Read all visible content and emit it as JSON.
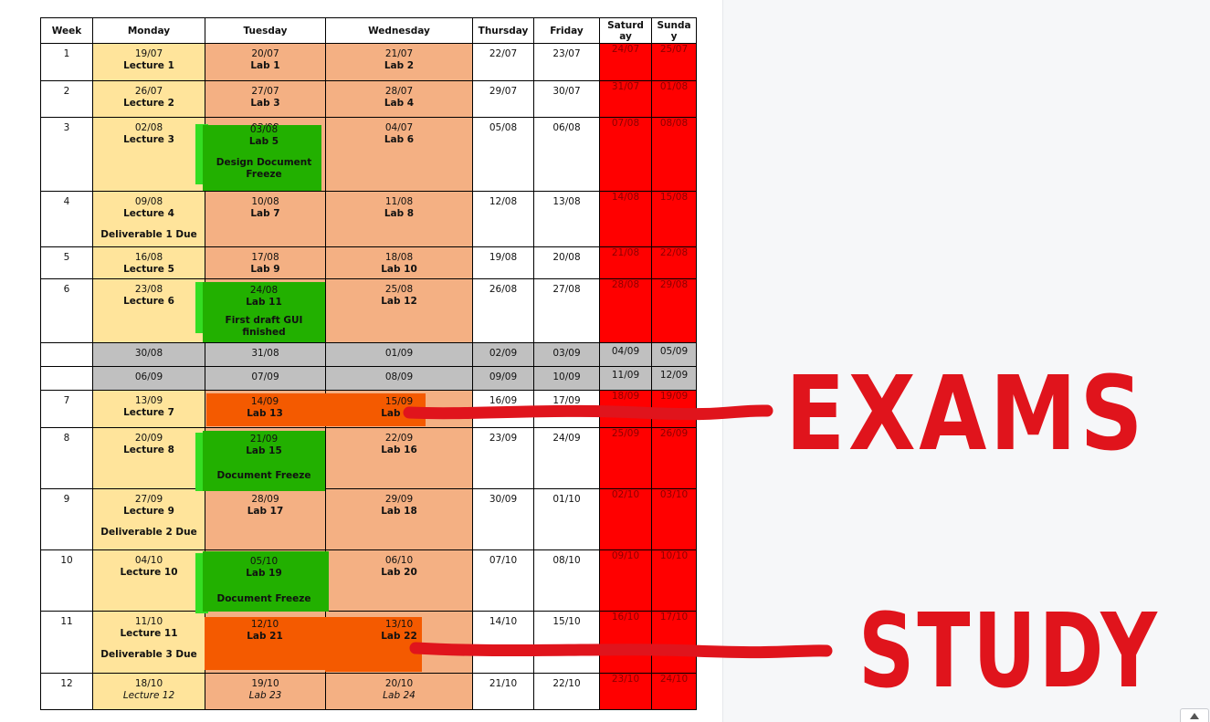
{
  "table": {
    "headers": [
      "Week",
      "Monday",
      "Tuesday",
      "Wednesday",
      "Thursday",
      "Friday",
      "Saturd\nay",
      "Sunda\ny"
    ],
    "rows": [
      {
        "week": "1",
        "mon": {
          "date": "19/07",
          "label": "Lecture 1"
        },
        "tue": {
          "date": "20/07",
          "label": "Lab 1"
        },
        "wed": {
          "date": "21/07",
          "label": "Lab 2"
        },
        "thu": "22/07",
        "fri": "23/07",
        "sat": "24/07",
        "sun": "25/07"
      },
      {
        "week": "2",
        "mon": {
          "date": "26/07",
          "label": "Lecture 2"
        },
        "tue": {
          "date": "27/07",
          "label": "Lab 3"
        },
        "wed": {
          "date": "28/07",
          "label": "Lab 4"
        },
        "thu": "29/07",
        "fri": "30/07",
        "sat": "31/07",
        "sun": "01/08"
      },
      {
        "week": "3",
        "mon": {
          "date": "02/08",
          "label": "Lecture 3"
        },
        "tue": {
          "date": "03/08",
          "label": "Lab 5",
          "note": "Design Document Freeze"
        },
        "wed": {
          "date": "04/07",
          "label": "Lab 6"
        },
        "thu": "05/08",
        "fri": "06/08",
        "sat": "07/08",
        "sun": "08/08"
      },
      {
        "week": "4",
        "mon": {
          "date": "09/08",
          "label": "Lecture 4",
          "note": "Deliverable 1 Due"
        },
        "tue": {
          "date": "10/08",
          "label": "Lab 7"
        },
        "wed": {
          "date": "11/08",
          "label": "Lab 8"
        },
        "thu": "12/08",
        "fri": "13/08",
        "sat": "14/08",
        "sun": "15/08"
      },
      {
        "week": "5",
        "mon": {
          "date": "16/08",
          "label": "Lecture 5"
        },
        "tue": {
          "date": "17/08",
          "label": "Lab 9"
        },
        "wed": {
          "date": "18/08",
          "label": "Lab 10"
        },
        "thu": "19/08",
        "fri": "20/08",
        "sat": "21/08",
        "sun": "22/08"
      },
      {
        "week": "6",
        "mon": {
          "date": "23/08",
          "label": "Lecture 6"
        },
        "tue": {
          "date": "24/08",
          "label": "Lab 11",
          "note": "First draft GUI finished"
        },
        "wed": {
          "date": "25/08",
          "label": "Lab 12"
        },
        "thu": "26/08",
        "fri": "27/08",
        "sat": "28/08",
        "sun": "29/08"
      },
      {
        "week": "",
        "break": true,
        "mon": {
          "date": "30/08"
        },
        "tue": {
          "date": "31/08"
        },
        "wed": {
          "date": "01/09"
        },
        "thu": "02/09",
        "fri": "03/09",
        "sat": "04/09",
        "sun": "05/09"
      },
      {
        "week": "",
        "break": true,
        "mon": {
          "date": "06/09"
        },
        "tue": {
          "date": "07/09"
        },
        "wed": {
          "date": "08/09"
        },
        "thu": "09/09",
        "fri": "10/09",
        "sat": "11/09",
        "sun": "12/09"
      },
      {
        "week": "7",
        "mon": {
          "date": "13/09",
          "label": "Lecture 7"
        },
        "tue": {
          "date": "14/09",
          "label": "Lab 13"
        },
        "wed": {
          "date": "15/09",
          "label": "Lab 14"
        },
        "thu": "16/09",
        "fri": "17/09",
        "sat": "18/09",
        "sun": "19/09"
      },
      {
        "week": "8",
        "mon": {
          "date": "20/09",
          "label": "Lecture 8"
        },
        "tue": {
          "date": "21/09",
          "label": "Lab 15",
          "note": "Document Freeze"
        },
        "wed": {
          "date": "22/09",
          "label": "Lab 16"
        },
        "thu": "23/09",
        "fri": "24/09",
        "sat": "25/09",
        "sun": "26/09"
      },
      {
        "week": "9",
        "mon": {
          "date": "27/09",
          "label": "Lecture 9",
          "note": "Deliverable 2 Due"
        },
        "tue": {
          "date": "28/09",
          "label": "Lab 17"
        },
        "wed": {
          "date": "29/09",
          "label": "Lab 18"
        },
        "thu": "30/09",
        "fri": "01/10",
        "sat": "02/10",
        "sun": "03/10"
      },
      {
        "week": "10",
        "mon": {
          "date": "04/10",
          "label": "Lecture 10"
        },
        "tue": {
          "date": "05/10",
          "label": "Lab 19",
          "note": "Document Freeze"
        },
        "wed": {
          "date": "06/10",
          "label": "Lab 20"
        },
        "thu": "07/10",
        "fri": "08/10",
        "sat": "09/10",
        "sun": "10/10"
      },
      {
        "week": "11",
        "mon": {
          "date": "11/10",
          "label": "Lecture 11",
          "note": "Deliverable 3 Due"
        },
        "tue": {
          "date": "12/10",
          "label": "Lab 21"
        },
        "wed": {
          "date": "13/10",
          "label": "Lab 22"
        },
        "thu": "14/10",
        "fri": "15/10",
        "sat": "16/10",
        "sun": "17/10"
      },
      {
        "week": "12",
        "italic": true,
        "mon": {
          "date": "18/10",
          "label": "Lecture 12"
        },
        "tue": {
          "date": "19/10",
          "label": "Lab 23"
        },
        "wed": {
          "date": "20/10",
          "label": "Lab 24"
        },
        "thu": "21/10",
        "fri": "22/10",
        "sat": "23/10",
        "sun": "24/10"
      }
    ]
  },
  "annotations": {
    "exams_label": "EXAMS",
    "study_label": "STUDY",
    "ink_color": "#e0141c"
  },
  "colors": {
    "lecture": "#ffe49b",
    "lab": "#f4b083",
    "weekend": "#ff0000",
    "break": "#c0c0c0",
    "freeze_highlight": "#22b000",
    "exam_highlight": "#f45a00"
  }
}
